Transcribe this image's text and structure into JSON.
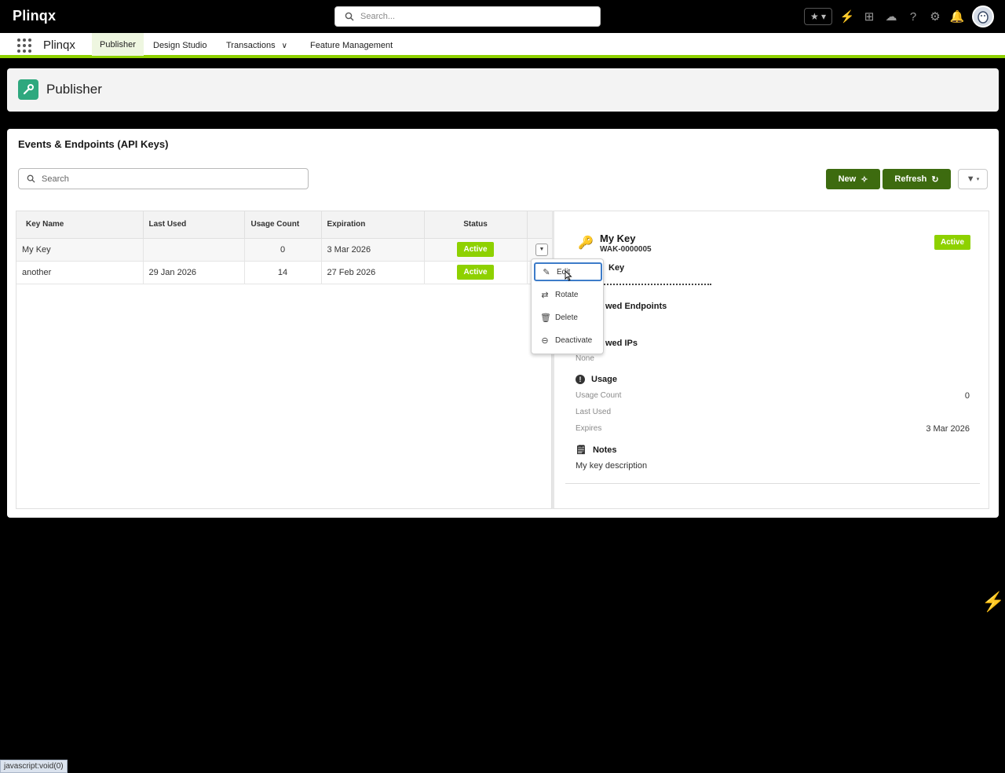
{
  "topbar": {
    "brand": "Plinqx",
    "search_placeholder": "Search...",
    "icons": [
      "favorites-star-icon",
      "lightning-icon",
      "add-icon",
      "cloud-icon",
      "help-icon",
      "gear-icon",
      "bell-icon",
      "avatar"
    ]
  },
  "nav": {
    "app_name": "Plinqx",
    "tabs": [
      {
        "label": "Publisher",
        "active": true
      },
      {
        "label": "Design Studio"
      },
      {
        "label": "Transactions",
        "has_dropdown": true
      },
      {
        "label": "Feature Management"
      }
    ]
  },
  "page": {
    "title": "Publisher"
  },
  "card": {
    "title": "Events & Endpoints (API Keys)",
    "search_placeholder": "Search",
    "new_label": "New",
    "refresh_label": "Refresh"
  },
  "table": {
    "columns": [
      "Key Name",
      "Last Used",
      "Usage Count",
      "Expiration",
      "Status"
    ],
    "rows": [
      {
        "name": "My Key",
        "last_used": "",
        "usage": "0",
        "expiration": "3 Mar 2026",
        "status": "Active"
      },
      {
        "name": "another",
        "last_used": "29 Jan 2026",
        "usage": "14",
        "expiration": "27 Feb 2026",
        "status": "Active"
      }
    ]
  },
  "menu": {
    "items": [
      {
        "label": "Edit",
        "icon": "pencil-icon"
      },
      {
        "label": "Rotate",
        "icon": "rotate-icon"
      },
      {
        "label": "Delete",
        "icon": "trash-icon"
      },
      {
        "label": "Deactivate",
        "icon": "deactivate-icon"
      }
    ]
  },
  "detail": {
    "name": "My Key",
    "id": "WAK-0000005",
    "status": "Active",
    "key_label": "Key",
    "endpoints_label": "wed Endpoints",
    "ips_label": "wed IPs",
    "ips_value": "None",
    "usage_label": "Usage",
    "usage_count_label": "Usage Count",
    "usage_count_value": "0",
    "last_used_label": "Last Used",
    "expires_label": "Expires",
    "expires_value": "3 Mar 2026",
    "notes_label": "Notes",
    "notes_value": "My key description"
  },
  "status_bar": {
    "url": "javascript:void(0)"
  },
  "colors": {
    "accent_green": "#8ed100",
    "button_green": "#3d6b0f",
    "publisher_icon": "#2ea87e"
  }
}
